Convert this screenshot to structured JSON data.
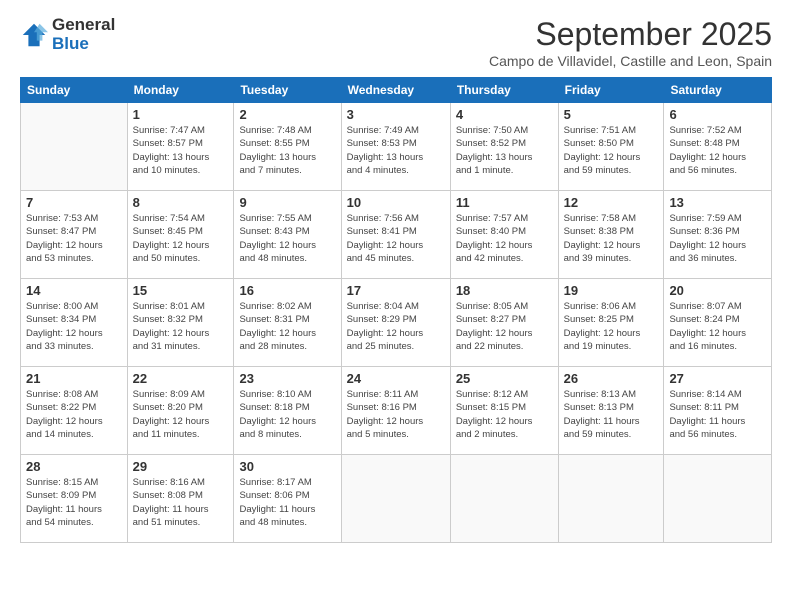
{
  "logo": {
    "general": "General",
    "blue": "Blue"
  },
  "title": "September 2025",
  "subtitle": "Campo de Villavidel, Castille and Leon, Spain",
  "days_of_week": [
    "Sunday",
    "Monday",
    "Tuesday",
    "Wednesday",
    "Thursday",
    "Friday",
    "Saturday"
  ],
  "weeks": [
    [
      {
        "day": "",
        "info": ""
      },
      {
        "day": "1",
        "info": "Sunrise: 7:47 AM\nSunset: 8:57 PM\nDaylight: 13 hours\nand 10 minutes."
      },
      {
        "day": "2",
        "info": "Sunrise: 7:48 AM\nSunset: 8:55 PM\nDaylight: 13 hours\nand 7 minutes."
      },
      {
        "day": "3",
        "info": "Sunrise: 7:49 AM\nSunset: 8:53 PM\nDaylight: 13 hours\nand 4 minutes."
      },
      {
        "day": "4",
        "info": "Sunrise: 7:50 AM\nSunset: 8:52 PM\nDaylight: 13 hours\nand 1 minute."
      },
      {
        "day": "5",
        "info": "Sunrise: 7:51 AM\nSunset: 8:50 PM\nDaylight: 12 hours\nand 59 minutes."
      },
      {
        "day": "6",
        "info": "Sunrise: 7:52 AM\nSunset: 8:48 PM\nDaylight: 12 hours\nand 56 minutes."
      }
    ],
    [
      {
        "day": "7",
        "info": "Sunrise: 7:53 AM\nSunset: 8:47 PM\nDaylight: 12 hours\nand 53 minutes."
      },
      {
        "day": "8",
        "info": "Sunrise: 7:54 AM\nSunset: 8:45 PM\nDaylight: 12 hours\nand 50 minutes."
      },
      {
        "day": "9",
        "info": "Sunrise: 7:55 AM\nSunset: 8:43 PM\nDaylight: 12 hours\nand 48 minutes."
      },
      {
        "day": "10",
        "info": "Sunrise: 7:56 AM\nSunset: 8:41 PM\nDaylight: 12 hours\nand 45 minutes."
      },
      {
        "day": "11",
        "info": "Sunrise: 7:57 AM\nSunset: 8:40 PM\nDaylight: 12 hours\nand 42 minutes."
      },
      {
        "day": "12",
        "info": "Sunrise: 7:58 AM\nSunset: 8:38 PM\nDaylight: 12 hours\nand 39 minutes."
      },
      {
        "day": "13",
        "info": "Sunrise: 7:59 AM\nSunset: 8:36 PM\nDaylight: 12 hours\nand 36 minutes."
      }
    ],
    [
      {
        "day": "14",
        "info": "Sunrise: 8:00 AM\nSunset: 8:34 PM\nDaylight: 12 hours\nand 33 minutes."
      },
      {
        "day": "15",
        "info": "Sunrise: 8:01 AM\nSunset: 8:32 PM\nDaylight: 12 hours\nand 31 minutes."
      },
      {
        "day": "16",
        "info": "Sunrise: 8:02 AM\nSunset: 8:31 PM\nDaylight: 12 hours\nand 28 minutes."
      },
      {
        "day": "17",
        "info": "Sunrise: 8:04 AM\nSunset: 8:29 PM\nDaylight: 12 hours\nand 25 minutes."
      },
      {
        "day": "18",
        "info": "Sunrise: 8:05 AM\nSunset: 8:27 PM\nDaylight: 12 hours\nand 22 minutes."
      },
      {
        "day": "19",
        "info": "Sunrise: 8:06 AM\nSunset: 8:25 PM\nDaylight: 12 hours\nand 19 minutes."
      },
      {
        "day": "20",
        "info": "Sunrise: 8:07 AM\nSunset: 8:24 PM\nDaylight: 12 hours\nand 16 minutes."
      }
    ],
    [
      {
        "day": "21",
        "info": "Sunrise: 8:08 AM\nSunset: 8:22 PM\nDaylight: 12 hours\nand 14 minutes."
      },
      {
        "day": "22",
        "info": "Sunrise: 8:09 AM\nSunset: 8:20 PM\nDaylight: 12 hours\nand 11 minutes."
      },
      {
        "day": "23",
        "info": "Sunrise: 8:10 AM\nSunset: 8:18 PM\nDaylight: 12 hours\nand 8 minutes."
      },
      {
        "day": "24",
        "info": "Sunrise: 8:11 AM\nSunset: 8:16 PM\nDaylight: 12 hours\nand 5 minutes."
      },
      {
        "day": "25",
        "info": "Sunrise: 8:12 AM\nSunset: 8:15 PM\nDaylight: 12 hours\nand 2 minutes."
      },
      {
        "day": "26",
        "info": "Sunrise: 8:13 AM\nSunset: 8:13 PM\nDaylight: 11 hours\nand 59 minutes."
      },
      {
        "day": "27",
        "info": "Sunrise: 8:14 AM\nSunset: 8:11 PM\nDaylight: 11 hours\nand 56 minutes."
      }
    ],
    [
      {
        "day": "28",
        "info": "Sunrise: 8:15 AM\nSunset: 8:09 PM\nDaylight: 11 hours\nand 54 minutes."
      },
      {
        "day": "29",
        "info": "Sunrise: 8:16 AM\nSunset: 8:08 PM\nDaylight: 11 hours\nand 51 minutes."
      },
      {
        "day": "30",
        "info": "Sunrise: 8:17 AM\nSunset: 8:06 PM\nDaylight: 11 hours\nand 48 minutes."
      },
      {
        "day": "",
        "info": ""
      },
      {
        "day": "",
        "info": ""
      },
      {
        "day": "",
        "info": ""
      },
      {
        "day": "",
        "info": ""
      }
    ]
  ]
}
